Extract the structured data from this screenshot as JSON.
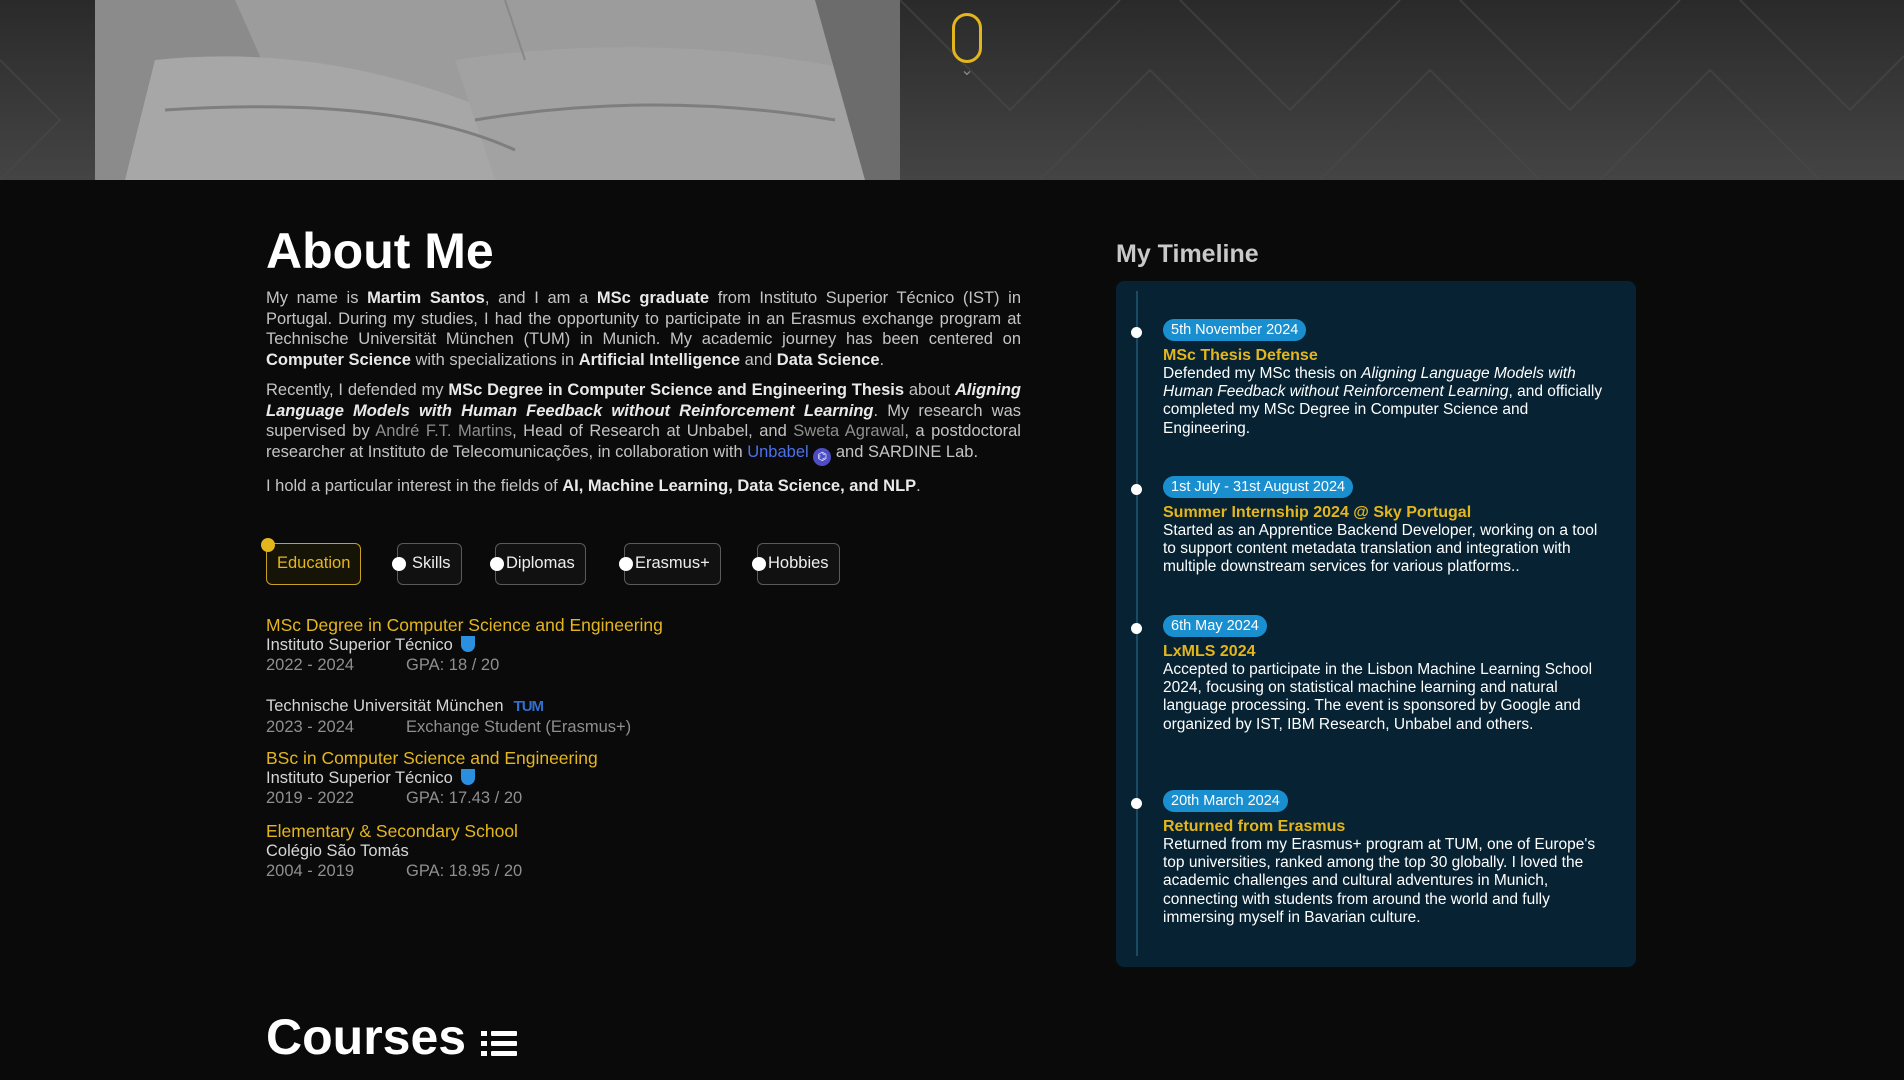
{
  "about": {
    "title": "About Me",
    "p1": [
      {
        "t": "My name is "
      },
      {
        "t": "Martim Santos",
        "b": true
      },
      {
        "t": ", and I am a "
      },
      {
        "t": "MSc graduate",
        "b": true
      },
      {
        "t": " from Instituto Superior Técnico (IST) in Portugal. During my studies, I had the opportunity to participate in an Erasmus exchange program at Technische Universität München (TUM) in Munich. My academic journey has been centered on "
      },
      {
        "t": "Computer Science",
        "b": true
      },
      {
        "t": " with specializations in "
      },
      {
        "t": "Artificial Intelligence",
        "b": true
      },
      {
        "t": " and "
      },
      {
        "t": "Data Science",
        "b": true
      },
      {
        "t": "."
      }
    ],
    "p2": [
      {
        "t": "Recently, I defended my "
      },
      {
        "t": "MSc Degree in Computer Science and Engineering Thesis",
        "b": true
      },
      {
        "t": " about "
      },
      {
        "t": "Aligning Language Models with Human Feedback without Reinforcement Learning",
        "bi": true
      },
      {
        "t": ". My research was supervised by "
      },
      {
        "t": "André F.T. Martins",
        "link": "grey"
      },
      {
        "t": ", Head of Research at Unbabel, and "
      },
      {
        "t": "Sweta Agrawal",
        "link": "grey"
      },
      {
        "t": ", a postdoctoral researcher at Instituto de Telecomunicações, in collaboration with "
      },
      {
        "t": "Unbabel",
        "link": "blue"
      },
      {
        "t": "icon",
        "icon": "unbabel-icon"
      },
      {
        "t": " and SARDINE Lab."
      }
    ],
    "p3": [
      {
        "t": "I hold a particular interest in the fields of "
      },
      {
        "t": "AI, Machine Learning, Data Science, and NLP",
        "b": true
      },
      {
        "t": "."
      }
    ]
  },
  "tabs": [
    "Education",
    "Skills",
    "Diplomas",
    "Erasmus+",
    "Hobbies"
  ],
  "active_tab": "Education",
  "education": [
    {
      "degree": "MSc Degree in Computer Science and Engineering",
      "institution": "Instituto Superior Técnico",
      "logo": "ist-shield-icon",
      "years": "2022 - 2024",
      "detail": "GPA: 18 / 20"
    },
    {
      "degree": "",
      "institution": "Technische Universität München",
      "logo": "tum-logo-icon",
      "logo_text": "TUM",
      "years": "2023 - 2024",
      "detail": "Exchange Student (Erasmus+)"
    },
    {
      "degree": "BSc in Computer Science and Engineering",
      "institution": "Instituto Superior Técnico",
      "logo": "ist-shield-icon",
      "years": "2019 - 2022",
      "detail": "GPA: 17.43 / 20"
    },
    {
      "degree": "Elementary & Secondary School",
      "institution": "Colégio São Tomás",
      "logo": "",
      "years": "2004 - 2019",
      "detail": "GPA: 18.95 / 20"
    }
  ],
  "timeline": {
    "title": "My Timeline",
    "items": [
      {
        "date": "5th November 2024",
        "title": "MSc Thesis Defense",
        "body": [
          {
            "t": "Defended my MSc thesis on "
          },
          {
            "t": "Aligning Language Models with Human Feedback without Reinforcement Learning",
            "i": true
          },
          {
            "t": ", and officially completed my MSc Degree in Computer Science and Engineering."
          }
        ]
      },
      {
        "date": "1st July - 31st August 2024",
        "title": "Summer Internship 2024 @ Sky Portugal",
        "body": [
          {
            "t": "Started as an Apprentice Backend Developer, working on a tool to support content metadata translation and integration with multiple downstream services for various platforms.."
          }
        ]
      },
      {
        "date": "6th May 2024",
        "title": "LxMLS 2024",
        "body": [
          {
            "t": "Accepted to participate in the Lisbon Machine Learning School 2024, focusing on statistical machine learning and natural language processing. The event is sponsored by Google and organized by IST, IBM Research, Unbabel and others."
          }
        ]
      },
      {
        "date": "20th March 2024",
        "title": "Returned from Erasmus",
        "body": [
          {
            "t": "Returned from my Erasmus+ program at TUM, one of Europe's top universities, ranked among the top 30 globally. I loved the academic challenges and cultural adventures in Munich, connecting with students from around the world and fully immersing myself in Bavarian culture."
          }
        ]
      }
    ]
  },
  "courses": {
    "title": "Courses",
    "icon": "list-icon"
  },
  "hero": {
    "scroll_icon": "scroll-mouse-icon"
  },
  "colors": {
    "accent": "#e4b61e",
    "timeline_bg": "#062233",
    "date_badge": "#1a8fd0",
    "background": "#0a0a0a"
  }
}
